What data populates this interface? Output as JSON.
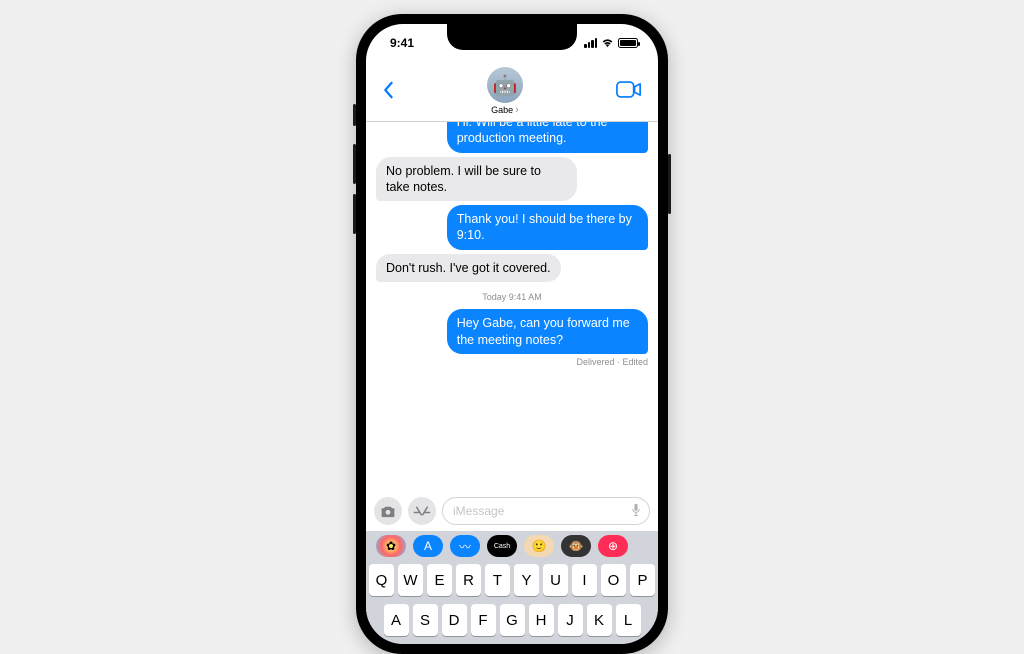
{
  "status_bar": {
    "time": "9:41"
  },
  "header": {
    "contact_name": "Gabe"
  },
  "messages": [
    {
      "side": "sent",
      "cutoff": true,
      "text": "Hi. Will be a little late to the production meeting."
    },
    {
      "side": "recv",
      "text": "No problem. I will be sure to take notes."
    },
    {
      "side": "sent",
      "text": "Thank you! I should be there by 9:10."
    },
    {
      "side": "recv",
      "text": "Don't rush. I've got it covered."
    }
  ],
  "timestamp": "Today 9:41 AM",
  "last_message": {
    "text": "Hey Gabe, can you forward me the meeting notes?"
  },
  "delivery_status": "Delivered · Edited",
  "input": {
    "placeholder": "iMessage"
  },
  "app_drawer": [
    {
      "name": "photos-app",
      "color": "radial-gradient(circle,#ff6,#f66,#6cf)",
      "glyph": "✿"
    },
    {
      "name": "app-store",
      "color": "#0a84ff",
      "glyph": "A",
      "glyphColor": "#fff"
    },
    {
      "name": "audio-app",
      "color": "#0a84ff",
      "glyph": "〰",
      "glyphColor": "#fff"
    },
    {
      "name": "apple-cash",
      "color": "#000",
      "glyph": "Cash",
      "glyphColor": "#fff",
      "small": true
    },
    {
      "name": "memoji-app",
      "color": "#f3d9b1",
      "glyph": "🙂"
    },
    {
      "name": "animoji-app",
      "color": "#333",
      "glyph": "🐵"
    },
    {
      "name": "search-app",
      "color": "#ff2d55",
      "glyph": "⊕",
      "glyphColor": "#fff"
    }
  ],
  "keyboard": {
    "row1": [
      "Q",
      "W",
      "E",
      "R",
      "T",
      "Y",
      "U",
      "I",
      "O",
      "P"
    ],
    "row2": [
      "A",
      "S",
      "D",
      "F",
      "G",
      "H",
      "J",
      "K",
      "L"
    ]
  }
}
